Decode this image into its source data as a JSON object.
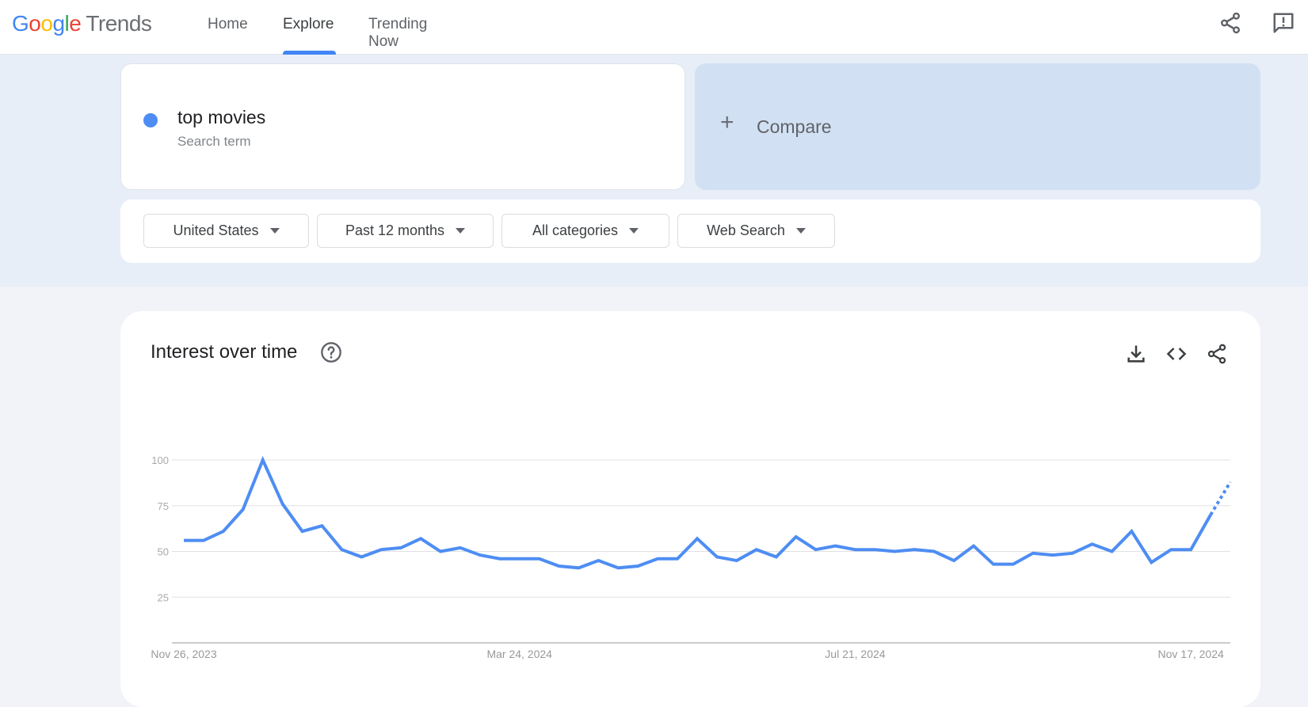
{
  "header": {
    "logo": {
      "google": [
        "G",
        "o",
        "o",
        "g",
        "l",
        "e"
      ],
      "product": "Trends"
    },
    "nav": [
      {
        "label": "Home",
        "active": false
      },
      {
        "label": "Explore",
        "active": true
      },
      {
        "label": "Trending Now",
        "active": false
      }
    ],
    "icons": [
      "share-icon",
      "feedback-icon"
    ],
    "accent_color": "#4285f4"
  },
  "search": {
    "term": "top movies",
    "term_type": "Search term",
    "term_color": "#4e8df3",
    "compare_label": "Compare"
  },
  "filters": [
    {
      "label": "United States"
    },
    {
      "label": "Past 12 months"
    },
    {
      "label": "All categories"
    },
    {
      "label": "Web Search"
    }
  ],
  "panel": {
    "title": "Interest over time",
    "actions": [
      "download-icon",
      "embed-icon",
      "share-icon"
    ]
  },
  "chart_data": {
    "type": "line",
    "title": "Interest over time",
    "xlabel": "",
    "ylabel": "",
    "ylim": [
      0,
      100
    ],
    "yticks": [
      25,
      50,
      75,
      100
    ],
    "xtick_labels": [
      {
        "label": "Nov 26, 2023",
        "index": 0
      },
      {
        "label": "Mar 24, 2024",
        "index": 17
      },
      {
        "label": "Jul 21, 2024",
        "index": 34
      },
      {
        "label": "Nov 17, 2024",
        "index": 51
      }
    ],
    "grid": true,
    "series": [
      {
        "name": "top movies",
        "color": "#4e8df3",
        "values": [
          56,
          56,
          61,
          73,
          100,
          76,
          61,
          64,
          51,
          47,
          51,
          52,
          57,
          50,
          52,
          48,
          46,
          46,
          46,
          42,
          41,
          45,
          41,
          42,
          46,
          46,
          57,
          47,
          45,
          51,
          47,
          58,
          51,
          53,
          51,
          51,
          50,
          51,
          50,
          45,
          53,
          43,
          43,
          49,
          48,
          49,
          54,
          50,
          61,
          44,
          51,
          51,
          70
        ],
        "partial_last_value": 88
      }
    ]
  }
}
